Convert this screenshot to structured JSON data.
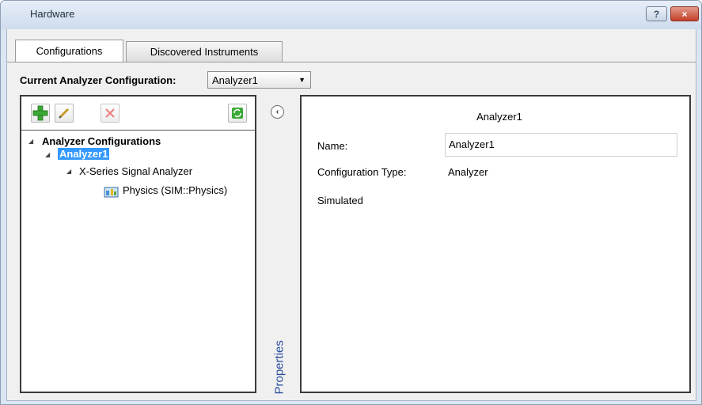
{
  "window": {
    "title": "Hardware",
    "help_label": "?",
    "close_label": "×"
  },
  "tabs": [
    {
      "label": "Configurations",
      "active": true
    },
    {
      "label": "Discovered Instruments",
      "active": false
    }
  ],
  "current_config": {
    "label": "Current Analyzer Configuration:",
    "value": "Analyzer1"
  },
  "toolbar": {
    "add_icon": "plus-icon",
    "edit_icon": "pencil-icon",
    "delete_icon": "delete-icon",
    "refresh_icon": "refresh-icon"
  },
  "tree": {
    "root": "Analyzer Configurations",
    "analyzer": "Analyzer1",
    "instrument": "X-Series Signal Analyzer",
    "physics": "Physics (SIM::Physics)"
  },
  "properties_panel": {
    "side_label": "Properties",
    "collapse_glyph": "‹",
    "title": "Analyzer1",
    "name_label": "Name:",
    "name_value": "Analyzer1",
    "config_type_label": "Configuration Type:",
    "config_type_value": "Analyzer",
    "simulated_label": "Simulated"
  },
  "colors": {
    "accent_selection": "#3399ff",
    "properties_text": "#2c4f9e",
    "add_green": "#3aa935",
    "delete_red": "#e86060"
  }
}
